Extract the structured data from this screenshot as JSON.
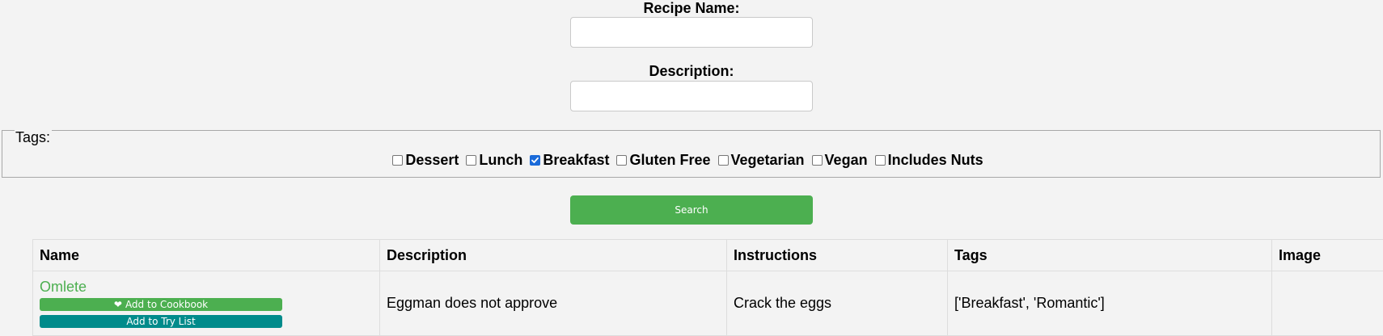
{
  "form": {
    "recipe_name_label": "Recipe Name:",
    "recipe_name_value": "",
    "description_label": "Description:",
    "description_value": "",
    "tags_legend": "Tags:",
    "tags": [
      {
        "label": "Dessert",
        "checked": false
      },
      {
        "label": "Lunch",
        "checked": false
      },
      {
        "label": "Breakfast",
        "checked": true
      },
      {
        "label": "Gluten Free",
        "checked": false
      },
      {
        "label": "Vegetarian",
        "checked": false
      },
      {
        "label": "Vegan",
        "checked": false
      },
      {
        "label": "Includes Nuts",
        "checked": false
      }
    ],
    "search_label": "Search"
  },
  "table": {
    "headers": [
      "Name",
      "Description",
      "Instructions",
      "Tags",
      "Image"
    ],
    "rows": [
      {
        "name": "Omlete",
        "add_cookbook_label": "Add to Cookbook",
        "add_trylist_label": "Add to Try List",
        "description": "Eggman does not approve",
        "instructions": "Crack the eggs",
        "tags": "['Breakfast', 'Romantic']",
        "image": ""
      }
    ]
  },
  "icons": {
    "heart": "heart-icon",
    "checkmark": "checkmark-icon"
  },
  "colors": {
    "accent": "#4caf50",
    "try_list": "#008b8b",
    "checkbox_checked": "#1a6ad9"
  }
}
